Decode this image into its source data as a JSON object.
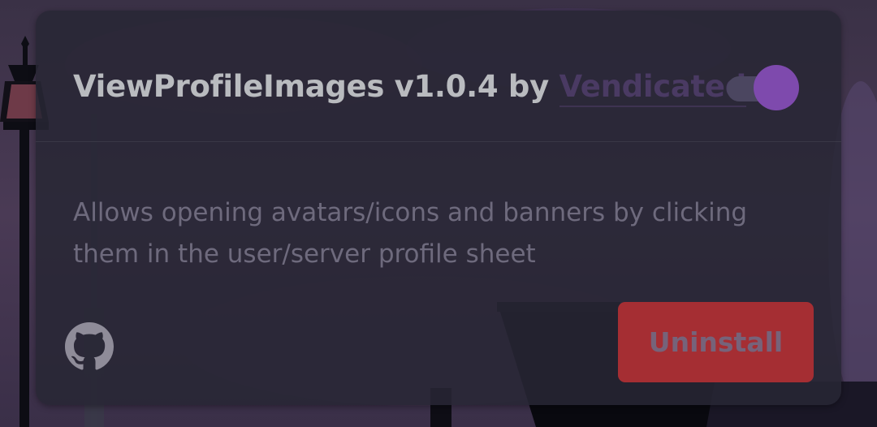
{
  "plugin": {
    "name_version": "ViewProfileImages v1.0.4 by ",
    "author": "Vendicated",
    "description": "Allows opening avatars/icons and banners by clicking them in the user/server profile sheet",
    "enabled": true
  },
  "actions": {
    "uninstall_label": "Uninstall",
    "source_icon": "github-icon"
  },
  "colors": {
    "toggle_accent": "#7e4aad",
    "danger": "#a52e33"
  }
}
